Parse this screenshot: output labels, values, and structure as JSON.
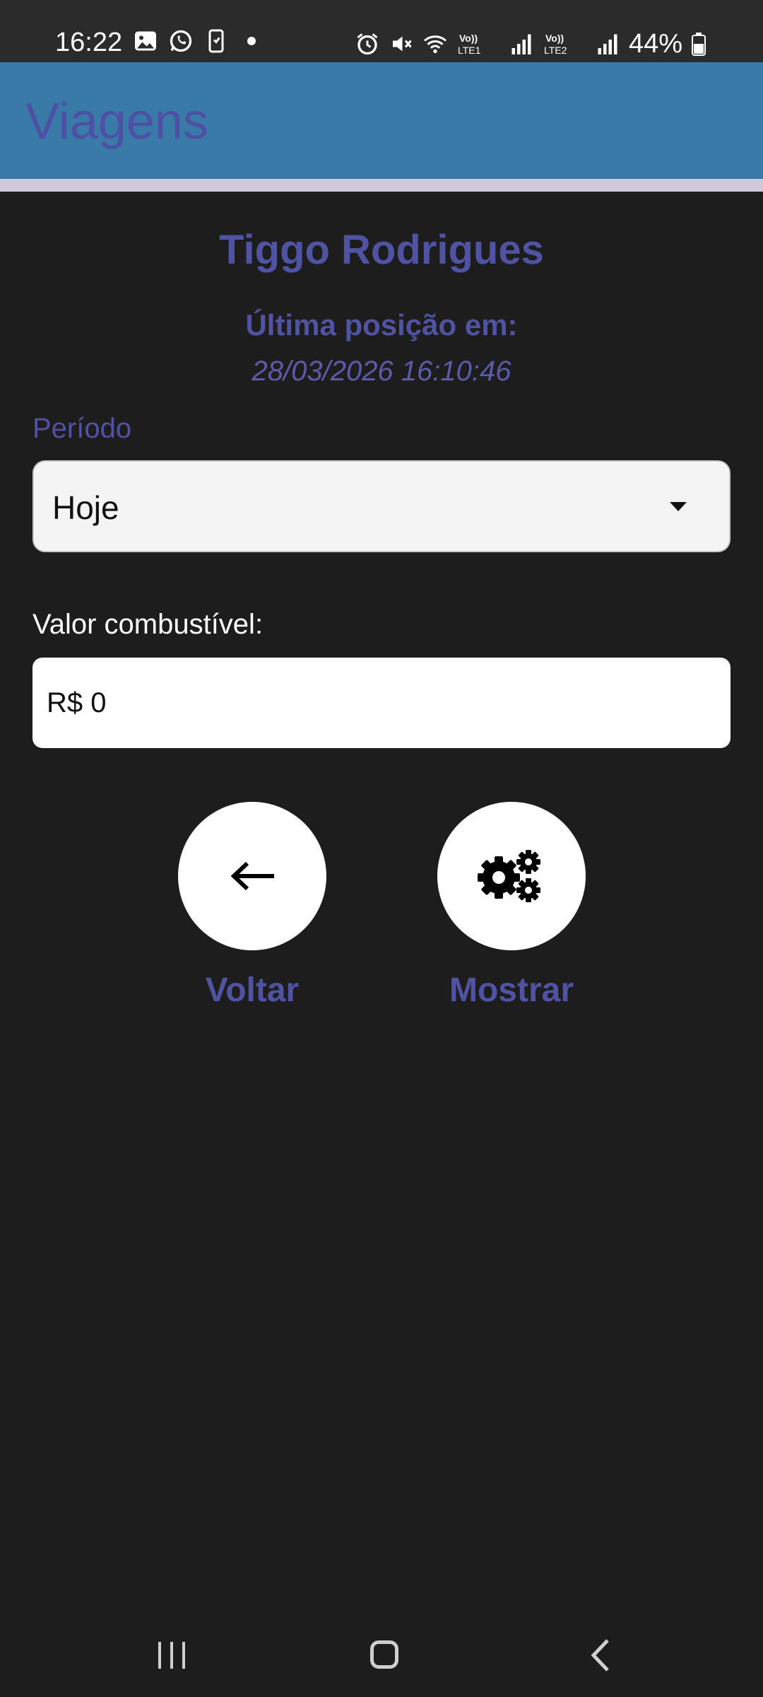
{
  "status_bar": {
    "time": "16:22",
    "battery": "44%",
    "network_1": "Vo) LTE1",
    "network_2": "Vo) LTE2",
    "left_icons": [
      "gallery-icon",
      "whatsapp-icon",
      "phone-sync-icon",
      "dot-icon"
    ],
    "right_icons": [
      "alarm-icon",
      "mute-icon",
      "wifi-icon",
      "signal-icon",
      "battery-icon"
    ]
  },
  "app_bar": {
    "title": "Viagens"
  },
  "vehicle": {
    "name": "Tiggo Rodrigues",
    "last_position_label": "Última posição em:",
    "last_position_value": "28/03/2026 16:10:46"
  },
  "period": {
    "label": "Período",
    "selected": "Hoje"
  },
  "fuel": {
    "label": "Valor combustível:",
    "value": "R$ 0"
  },
  "actions": {
    "back_label": "Voltar",
    "back_icon": "arrow-left-icon",
    "show_label": "Mostrar",
    "show_icon": "gears-icon"
  },
  "colors": {
    "app_bar_bg": "#3a7aa9",
    "accent_text": "#5052a2",
    "background": "#1d1d1e"
  },
  "nav_bar": {
    "buttons": [
      "recents-icon",
      "home-icon",
      "back-icon"
    ]
  }
}
